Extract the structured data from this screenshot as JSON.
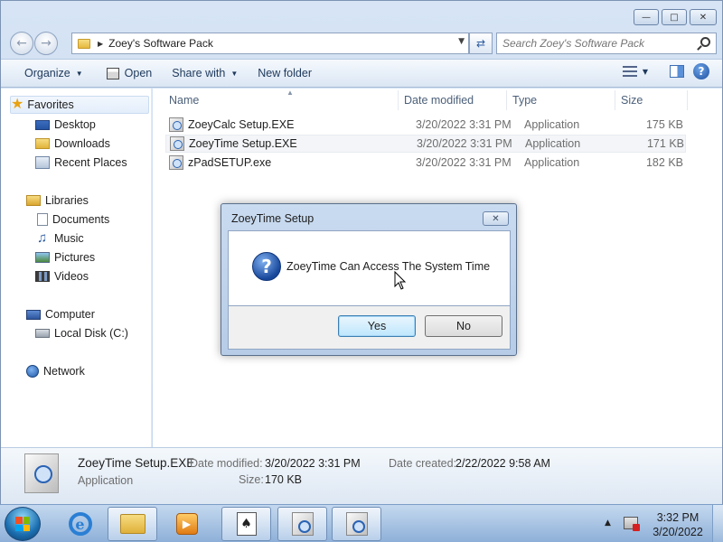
{
  "window": {
    "address": {
      "path": "Zoey's Software Pack",
      "search_placeholder": "Search Zoey's Software Pack"
    },
    "caption_buttons": [
      "minimize",
      "maximize",
      "close"
    ]
  },
  "toolbar": {
    "organize": "Organize",
    "open": "Open",
    "share_with": "Share with",
    "new_folder": "New folder"
  },
  "nav": {
    "favorites": "Favorites",
    "desktop": "Desktop",
    "downloads": "Downloads",
    "recent_places": "Recent Places",
    "libraries": "Libraries",
    "documents": "Documents",
    "music": "Music",
    "pictures": "Pictures",
    "videos": "Videos",
    "computer": "Computer",
    "local_disk": "Local Disk (C:)",
    "network": "Network"
  },
  "file_list": {
    "columns": {
      "name": "Name",
      "date_modified": "Date modified",
      "type": "Type",
      "size": "Size"
    },
    "files": [
      {
        "name": "ZoeyCalc Setup.EXE",
        "date": "3/20/2022 3:31 PM",
        "type": "Application",
        "size": "175 KB"
      },
      {
        "name": "ZoeyTime Setup.EXE",
        "date": "3/20/2022 3:31 PM",
        "type": "Application",
        "size": "171 KB"
      },
      {
        "name": "zPadSETUP.exe",
        "date": "3/20/2022 3:31 PM",
        "type": "Application",
        "size": "182 KB"
      }
    ]
  },
  "details": {
    "name": "ZoeyTime Setup.EXE",
    "type": "Application",
    "date_modified_label": "Date modified:",
    "date_modified": "3/20/2022 3:31 PM",
    "size_label": "Size:",
    "size": "170 KB",
    "date_created_label": "Date created:",
    "date_created": "2/22/2022 9:58 AM"
  },
  "dialog": {
    "title": "ZoeyTime Setup",
    "message": "ZoeyTime Can Access The System Time",
    "yes": "Yes",
    "no": "No",
    "icon": "question-icon"
  },
  "taskbar": {
    "time": "3:32 PM",
    "date": "3/20/2022",
    "apps": [
      "internet-explorer",
      "windows-explorer",
      "media-player",
      "solitaire",
      "media-center",
      "setup"
    ]
  },
  "colors": {
    "accent": "#1e395b",
    "selection": "#f3f5f8",
    "default_button": "#bee6fd"
  }
}
